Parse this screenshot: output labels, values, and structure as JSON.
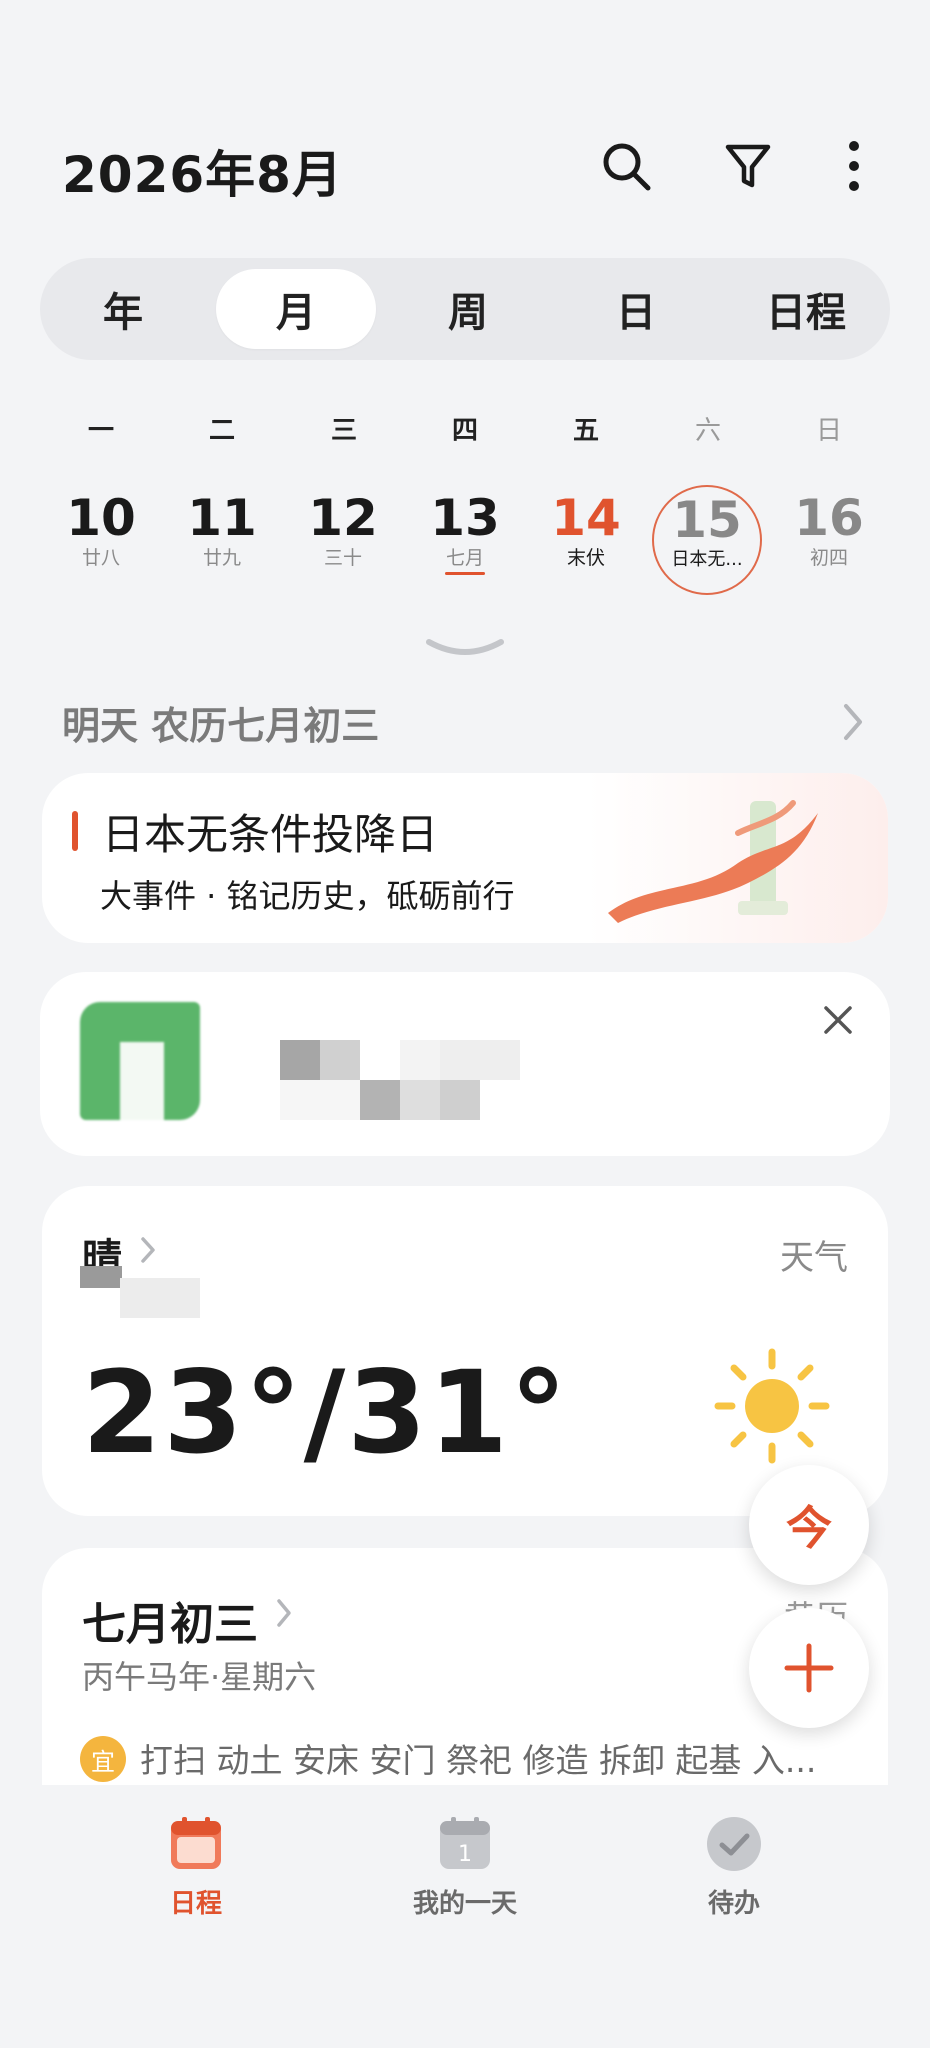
{
  "header": {
    "title": "2026年8月"
  },
  "view_tabs": [
    {
      "label": "年",
      "active": false
    },
    {
      "label": "月",
      "active": true
    },
    {
      "label": "周",
      "active": false
    },
    {
      "label": "日",
      "active": false
    },
    {
      "label": "日程",
      "active": false
    }
  ],
  "weekdays": [
    "一",
    "二",
    "三",
    "四",
    "五",
    "六",
    "日"
  ],
  "days": [
    {
      "num": "10",
      "sub": "廿八"
    },
    {
      "num": "11",
      "sub": "廿九"
    },
    {
      "num": "12",
      "sub": "三十"
    },
    {
      "num": "13",
      "sub": "七月"
    },
    {
      "num": "14",
      "sub": "末伏"
    },
    {
      "num": "15",
      "sub": "日本无..."
    },
    {
      "num": "16",
      "sub": "初四"
    }
  ],
  "date_subheader": "明天 农历七月初三",
  "event_card": {
    "title": "日本无条件投降日",
    "subtitle": "大事件 · 铭记历史，砥砺前行"
  },
  "weather": {
    "condition": "晴",
    "label": "天气",
    "temperature": "23°/31°"
  },
  "lunar": {
    "title": "七月初三",
    "label": "黄历",
    "subtitle": "丙午马年·星期六",
    "yi_badge": "宜",
    "items": "打扫 动土 安床 安门 祭祀 修造 拆卸 起基 入..."
  },
  "fab": {
    "today_label": "今"
  },
  "bottom_nav": [
    {
      "label": "日程",
      "active": true
    },
    {
      "label": "我的一天",
      "active": false
    },
    {
      "label": "待办",
      "active": false
    }
  ],
  "colors": {
    "accent": "#e0532e",
    "background": "#f3f4f6",
    "sun": "#f7c443"
  },
  "icons": [
    "search-icon",
    "filter-icon",
    "more-vert-icon",
    "chevron-down-icon",
    "chevron-right-icon",
    "close-icon",
    "sun-icon",
    "plus-icon",
    "calendar-icon",
    "my-day-icon",
    "check-circle-icon"
  ]
}
